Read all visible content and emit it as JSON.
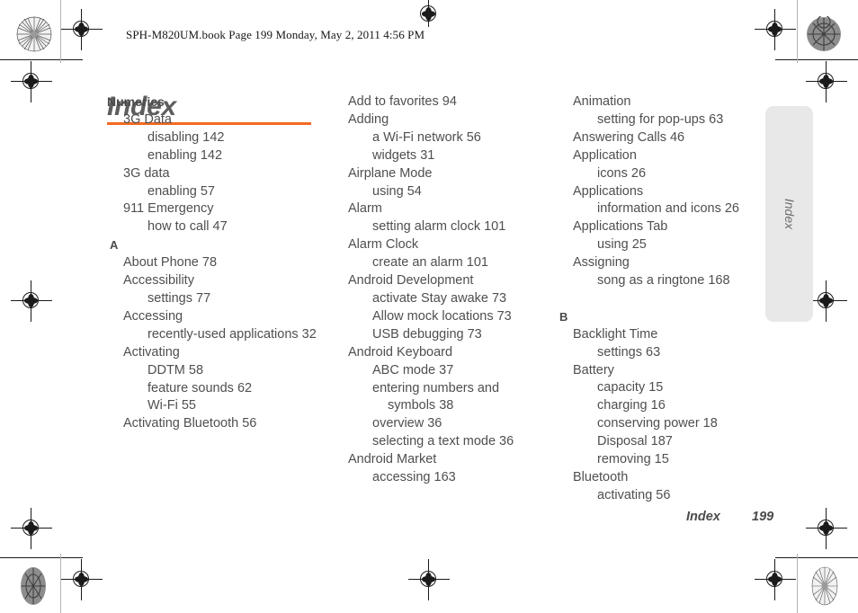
{
  "header": {
    "book_line": "SPH-M820UM.book  Page 199  Monday, May 2, 2011  4:56 PM"
  },
  "title": "Index",
  "side_tab": {
    "label": "Index"
  },
  "footer": {
    "label": "Index",
    "page_number": "199"
  },
  "colors": {
    "accent_rule": "#f26a21",
    "text": "#4f4f4f",
    "side_tab_bg": "#e8e8e8"
  },
  "columns": [
    {
      "name": "column-1",
      "lines": [
        {
          "type": "heading",
          "text": "Numerics"
        },
        {
          "type": "entry",
          "level": 1,
          "text": "3G Data"
        },
        {
          "type": "entry",
          "level": 2,
          "text": "disabling 142"
        },
        {
          "type": "entry",
          "level": 2,
          "text": "enabling 142"
        },
        {
          "type": "entry",
          "level": 1,
          "text": "3G data"
        },
        {
          "type": "entry",
          "level": 2,
          "text": "enabling 57"
        },
        {
          "type": "entry",
          "level": 1,
          "text": "911 Emergency"
        },
        {
          "type": "entry",
          "level": 2,
          "text": "how to call 47"
        },
        {
          "type": "letter",
          "text": "A"
        },
        {
          "type": "entry",
          "level": 1,
          "text": "About Phone 78"
        },
        {
          "type": "entry",
          "level": 1,
          "text": "Accessibility"
        },
        {
          "type": "entry",
          "level": 2,
          "text": "settings 77"
        },
        {
          "type": "entry",
          "level": 1,
          "text": "Accessing"
        },
        {
          "type": "entry",
          "level": 2,
          "text": "recently-used applications 32"
        },
        {
          "type": "entry",
          "level": 1,
          "text": "Activating"
        },
        {
          "type": "entry",
          "level": 2,
          "text": "DDTM 58"
        },
        {
          "type": "entry",
          "level": 2,
          "text": "feature sounds 62"
        },
        {
          "type": "entry",
          "level": 2,
          "text": "Wi-Fi 55"
        },
        {
          "type": "entry",
          "level": 1,
          "text": "Activating Bluetooth 56"
        }
      ]
    },
    {
      "name": "column-2",
      "lines": [
        {
          "type": "entry",
          "level": 1,
          "text": "Add to favorites 94"
        },
        {
          "type": "entry",
          "level": 1,
          "text": "Adding"
        },
        {
          "type": "entry",
          "level": 2,
          "text": "a Wi-Fi network 56"
        },
        {
          "type": "entry",
          "level": 2,
          "text": "widgets 31"
        },
        {
          "type": "entry",
          "level": 1,
          "text": "Airplane Mode"
        },
        {
          "type": "entry",
          "level": 2,
          "text": "using 54"
        },
        {
          "type": "entry",
          "level": 1,
          "text": "Alarm"
        },
        {
          "type": "entry",
          "level": 2,
          "text": "setting alarm clock 101"
        },
        {
          "type": "entry",
          "level": 1,
          "text": "Alarm Clock"
        },
        {
          "type": "entry",
          "level": 2,
          "text": "create an alarm 101"
        },
        {
          "type": "entry",
          "level": 1,
          "text": "Android Development"
        },
        {
          "type": "entry",
          "level": 2,
          "text": "activate Stay awake 73"
        },
        {
          "type": "entry",
          "level": 2,
          "text": "Allow mock locations 73"
        },
        {
          "type": "entry",
          "level": 2,
          "text": "USB debugging 73"
        },
        {
          "type": "entry",
          "level": 1,
          "text": "Android Keyboard"
        },
        {
          "type": "entry",
          "level": 2,
          "text": "ABC mode 37"
        },
        {
          "type": "entry",
          "level": 2,
          "text": "entering numbers and"
        },
        {
          "type": "entry",
          "level": 3,
          "text": "symbols 38"
        },
        {
          "type": "entry",
          "level": 2,
          "text": "overview 36"
        },
        {
          "type": "entry",
          "level": 2,
          "text": "selecting a text mode 36"
        },
        {
          "type": "entry",
          "level": 1,
          "text": "Android Market"
        },
        {
          "type": "entry",
          "level": 2,
          "text": "accessing 163"
        }
      ]
    },
    {
      "name": "column-3",
      "lines": [
        {
          "type": "entry",
          "level": 1,
          "text": "Animation"
        },
        {
          "type": "entry",
          "level": 2,
          "text": "setting for pop-ups 63"
        },
        {
          "type": "entry",
          "level": 1,
          "text": "Answering Calls 46"
        },
        {
          "type": "entry",
          "level": 1,
          "text": "Application"
        },
        {
          "type": "entry",
          "level": 2,
          "text": "icons 26"
        },
        {
          "type": "entry",
          "level": 1,
          "text": "Applications"
        },
        {
          "type": "entry",
          "level": 2,
          "text": "information and icons 26"
        },
        {
          "type": "entry",
          "level": 1,
          "text": "Applications Tab"
        },
        {
          "type": "entry",
          "level": 2,
          "text": "using 25"
        },
        {
          "type": "entry",
          "level": 1,
          "text": "Assigning"
        },
        {
          "type": "entry",
          "level": 2,
          "text": "song as a ringtone 168"
        },
        {
          "type": "letter",
          "text": "B"
        },
        {
          "type": "entry",
          "level": 1,
          "text": "Backlight Time"
        },
        {
          "type": "entry",
          "level": 2,
          "text": "settings 63"
        },
        {
          "type": "entry",
          "level": 1,
          "text": "Battery"
        },
        {
          "type": "entry",
          "level": 2,
          "text": "capacity 15"
        },
        {
          "type": "entry",
          "level": 2,
          "text": "charging 16"
        },
        {
          "type": "entry",
          "level": 2,
          "text": "conserving power 18"
        },
        {
          "type": "entry",
          "level": 2,
          "text": "Disposal 187"
        },
        {
          "type": "entry",
          "level": 2,
          "text": "removing 15"
        },
        {
          "type": "entry",
          "level": 1,
          "text": "Bluetooth"
        },
        {
          "type": "entry",
          "level": 2,
          "text": "activating 56"
        }
      ]
    }
  ]
}
